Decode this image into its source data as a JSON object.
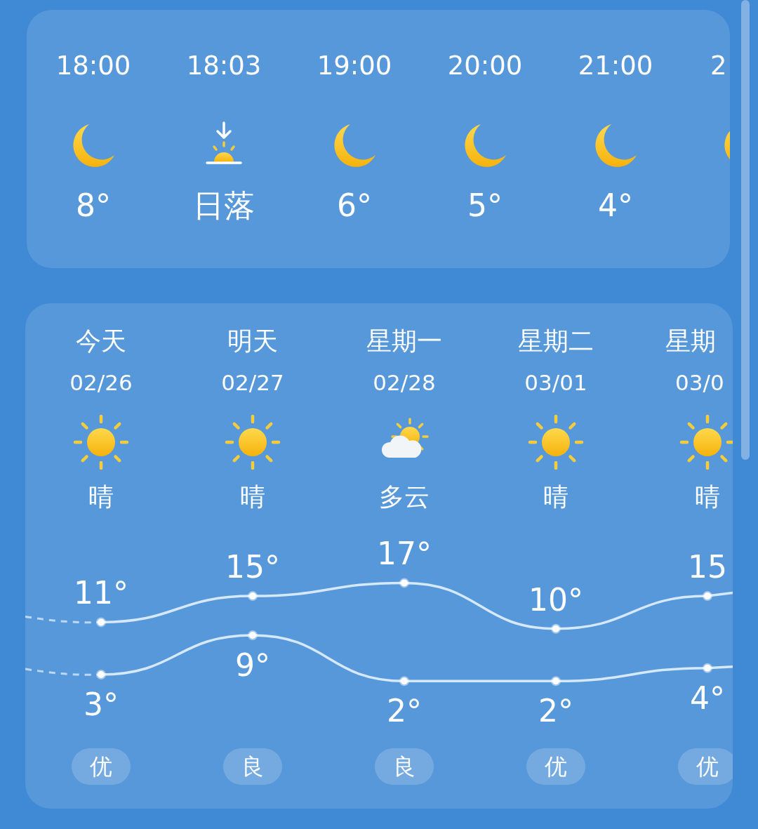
{
  "hourly": [
    {
      "time": "18:00",
      "kind": "moon",
      "temp": "8°"
    },
    {
      "time": "18:03",
      "kind": "sunset",
      "temp": "日落"
    },
    {
      "time": "19:00",
      "kind": "moon",
      "temp": "6°"
    },
    {
      "time": "20:00",
      "kind": "moon",
      "temp": "5°"
    },
    {
      "time": "21:00",
      "kind": "moon",
      "temp": "4°"
    },
    {
      "time": "2",
      "kind": "moon"
    }
  ],
  "daily": [
    {
      "day": "今天",
      "date": "02/26",
      "kind": "sun",
      "condition": "晴",
      "high": "11°",
      "low": "3°",
      "aqi": "优"
    },
    {
      "day": "明天",
      "date": "02/27",
      "kind": "sun",
      "condition": "晴",
      "high": "15°",
      "low": "9°",
      "aqi": "良"
    },
    {
      "day": "星期一",
      "date": "02/28",
      "kind": "partly-cloudy",
      "condition": "多云",
      "high": "17°",
      "low": "2°",
      "aqi": "良"
    },
    {
      "day": "星期二",
      "date": "03/01",
      "kind": "sun",
      "condition": "晴",
      "high": "10°",
      "low": "2°",
      "aqi": "优"
    },
    {
      "day": "星期",
      "date": "03/0",
      "kind": "sun",
      "condition": "晴",
      "high": "15",
      "low": "4°",
      "aqi": "优"
    }
  ]
}
